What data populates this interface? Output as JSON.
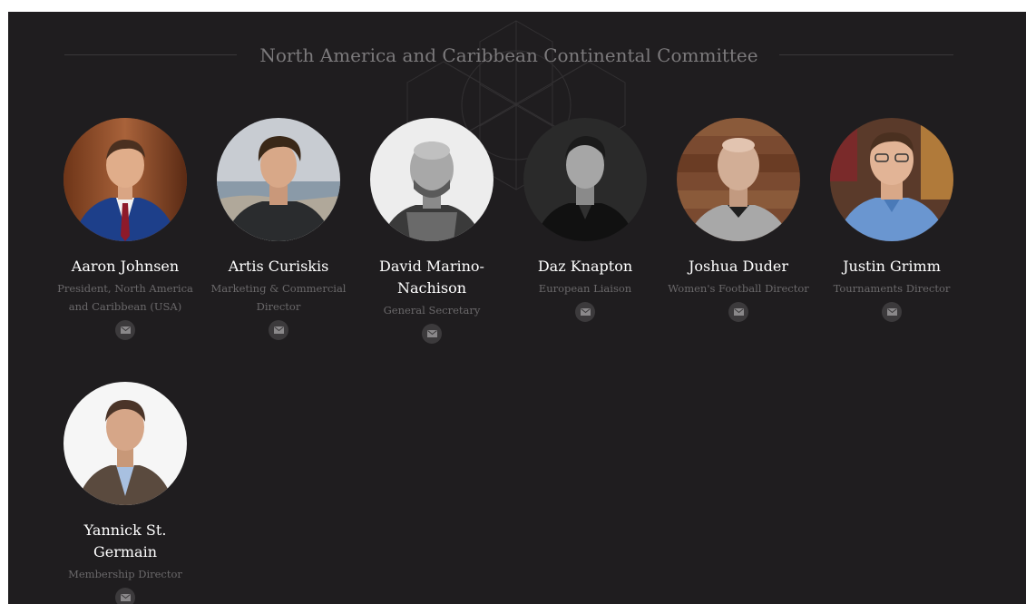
{
  "section": {
    "title": "North America and Caribbean Continental Committee"
  },
  "members": [
    {
      "name": "Aaron Johnsen",
      "role": "President, North America and Caribbean (USA)",
      "icon": "email-icon"
    },
    {
      "name": "Artis Curiskis",
      "role": "Marketing & Commercial Director",
      "icon": "email-icon"
    },
    {
      "name": "David Marino-Nachison",
      "role": "General Secretary",
      "icon": "email-icon"
    },
    {
      "name": "Daz Knapton",
      "role": "European Liaison",
      "icon": "email-icon"
    },
    {
      "name": "Joshua Duder",
      "role": "Women's Football Director",
      "icon": "email-icon"
    },
    {
      "name": "Justin Grimm",
      "role": "Tournaments Director",
      "icon": "email-icon"
    },
    {
      "name": "Yannick St. Germain",
      "role": "Membership Director",
      "icon": "email-icon"
    }
  ],
  "colors": {
    "background": "#1f1d1f",
    "heading": "#7c7a7c",
    "name": "#ffffff",
    "role": "#6a686a",
    "icon_bg": "#3c3a3c"
  }
}
